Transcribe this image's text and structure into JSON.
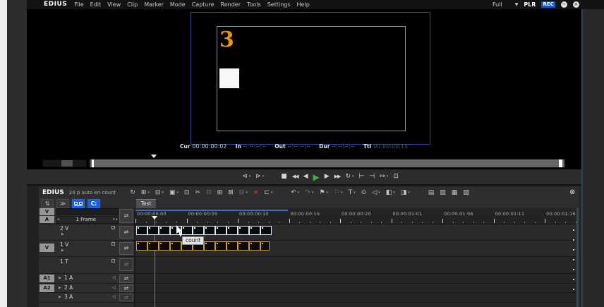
{
  "menu_bar": {
    "logo": "EDIUS",
    "items": [
      "File",
      "Edit",
      "View",
      "Clip",
      "Marker",
      "Mode",
      "Capture",
      "Render",
      "Tools",
      "Settings",
      "Help"
    ],
    "view_mode": "Full",
    "plr": "PLR",
    "rec": "REC"
  },
  "icons": {
    "minimize": "−",
    "close": "×",
    "dropdown": "▾",
    "dropdown_big": "▼",
    "timeline_close": "⊗",
    "left_spin": "◂",
    "right_spin": "▸",
    "expander": "▶",
    "speaker": "◁",
    "patch": "⇌"
  },
  "player": {
    "countdown_number": "3",
    "timecodes": [
      {
        "label": "Cur",
        "value": "00:00:00:02",
        "style": "cur"
      },
      {
        "label": "In",
        "value": "--:--:--:--",
        "style": ""
      },
      {
        "label": "Out",
        "value": "--:--:--:--",
        "style": ""
      },
      {
        "label": "Dur",
        "value": "--:--:--:--",
        "style": ""
      },
      {
        "label": "Ttl",
        "value": "00:00:00:15",
        "style": "dim"
      }
    ]
  },
  "transport": {
    "buttons": [
      {
        "name": "prev-edit-point-icon",
        "glyph": "⊲",
        "caret": true
      },
      {
        "name": "next-edit-point-icon",
        "glyph": "⊳",
        "caret": true
      },
      {
        "spacer": true
      },
      {
        "name": "stop-icon",
        "glyph": "■"
      },
      {
        "name": "rewind-icon",
        "glyph": "◀◀",
        "narrow": true
      },
      {
        "name": "prev-frame-icon",
        "glyph": "◀"
      },
      {
        "name": "play-icon",
        "glyph": "▶",
        "green": true
      },
      {
        "name": "next-frame-icon",
        "glyph": "▶"
      },
      {
        "name": "fast-forward-icon",
        "glyph": "▶▶",
        "narrow": true
      },
      {
        "name": "loop-playback-icon",
        "glyph": "↻",
        "caret": true
      },
      {
        "name": "goto-in-icon",
        "glyph": "⊢"
      },
      {
        "name": "goto-out-icon",
        "glyph": "⊣"
      },
      {
        "name": "goto-next-edit-icon",
        "glyph": "↦",
        "caret": true
      },
      {
        "name": "export-icon",
        "glyph": "⊡"
      }
    ]
  },
  "timeline": {
    "logo": "EDIUS",
    "project_name": "24 p auto en count",
    "sequence_tab": "Test",
    "duration_preset": "1 Frame",
    "tooltip": "count",
    "toolbar_icons": [
      {
        "name": "refresh-project-icon",
        "glyph": "↻"
      },
      {
        "name": "new-sequence-icon",
        "glyph": "⊞",
        "caret": true
      },
      {
        "name": "open-project-icon",
        "glyph": "⊟",
        "caret": true
      },
      {
        "name": "save-project-icon",
        "glyph": "▣",
        "caret": true
      },
      {
        "name": "add-cut-point-icon",
        "glyph": "⊡"
      },
      {
        "name": "cut-icon",
        "glyph": "✂"
      },
      {
        "name": "ripple-cut-icon",
        "glyph": "⊟",
        "dim": true
      },
      {
        "name": "copy-icon",
        "glyph": "⊞"
      },
      {
        "name": "paste-icon",
        "glyph": "⊠"
      },
      {
        "name": "replace-icon",
        "glyph": "⊟",
        "dim": true,
        "caret": true
      },
      {
        "name": "delete-icon",
        "glyph": "×",
        "red": true
      },
      {
        "name": "set-in-out-icon",
        "glyph": "⊏",
        "caret": true
      },
      {
        "spacer": true
      },
      {
        "name": "undo-icon",
        "glyph": "↶",
        "caret": true
      },
      {
        "name": "redo-icon",
        "glyph": "↷",
        "dim": true,
        "caret": true
      },
      {
        "name": "add-marker-icon",
        "glyph": "⚑",
        "caret": true
      },
      {
        "name": "mute-icon",
        "glyph": "⚐",
        "dim": true,
        "caret": true
      },
      {
        "name": "title-icon",
        "glyph": "T",
        "caret": true
      },
      {
        "name": "speech-icon",
        "glyph": "⊙"
      },
      {
        "name": "narration-icon",
        "glyph": "◁",
        "caret": true
      },
      {
        "name": "transition-icon",
        "glyph": "◧",
        "caret": true
      },
      {
        "name": "audio-fade-icon",
        "glyph": "◨",
        "caret": true
      },
      {
        "spacer": true
      },
      {
        "name": "panel-layout-icon-1",
        "glyph": "▤"
      },
      {
        "name": "panel-layout-icon-2",
        "glyph": "▥"
      },
      {
        "name": "panel-layout-icon-3",
        "glyph": "▦"
      },
      {
        "name": "panel-layout-icon-4",
        "glyph": "▧"
      }
    ],
    "mode_buttons": [
      {
        "name": "sync-mode-icon",
        "glyph": "⇅"
      },
      {
        "name": "ripple-mode-icon",
        "glyph": "≫"
      },
      {
        "name": "insert-overwrite-mode-icon",
        "special": "ow",
        "active": true
      },
      {
        "name": "sync-lock-mode-icon",
        "glyph": "C:",
        "active": true
      }
    ],
    "patches": {
      "video_source": "V",
      "audio_source": "A",
      "v_track": "V",
      "a1": "A1",
      "a2": "A2"
    },
    "tracks": {
      "v2": "2 V",
      "v1": "1 V",
      "t1": "1 T",
      "a1": "1 A",
      "a2": "2 A",
      "a3": "3 A"
    },
    "ruler": {
      "labels": [
        "00:00:00:00",
        "00:00:00:05",
        "00:00:00:10",
        "00:00:00:15",
        "00:00:00:20",
        "00:00:01:01",
        "00:00:01:06",
        "00:00:01:11",
        "00:00:01:16"
      ],
      "label_spacing_px": 72.5,
      "minor_ticks_per_major": 5
    },
    "clips": {
      "video": {
        "track": "2 V",
        "segments": 12,
        "selected": true
      },
      "title": {
        "track": "1 V",
        "segments": 12,
        "selected": false
      }
    }
  },
  "colors": {
    "accent_blue": "#1d5ed2",
    "rec_blue": "#1558c0",
    "play_green": "#3fae3f",
    "countdown_orange": "#e8940f",
    "clip_selected_border": "#dfe7f5",
    "clip_yellow_border": "#c9a33b",
    "playhead_teal": "#4fb5ad",
    "preview_border_blue": "#2d4d9b"
  }
}
